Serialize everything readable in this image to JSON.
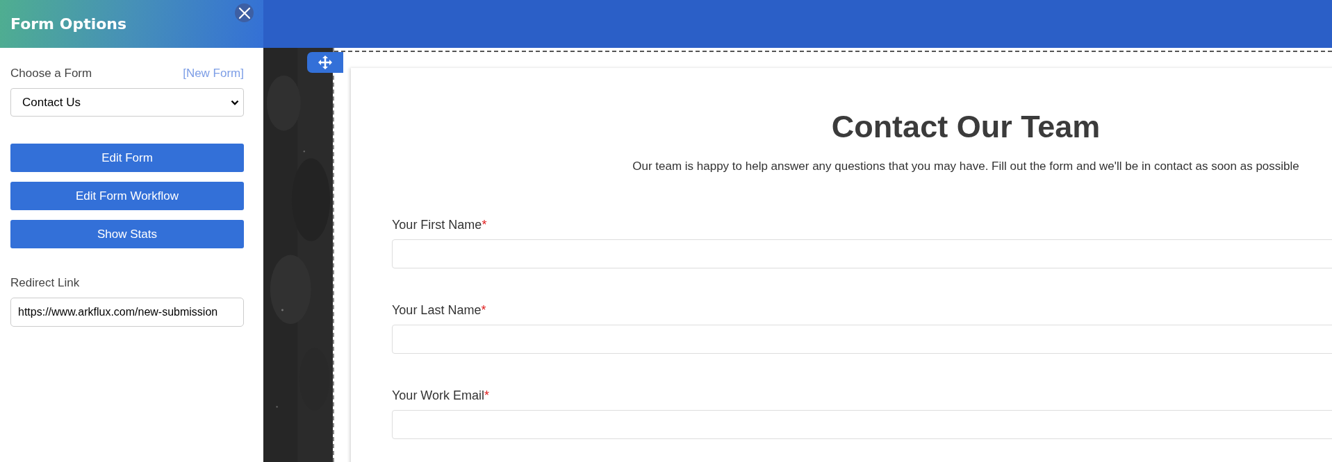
{
  "sidebar": {
    "title": "Form Options",
    "choose_label": "Choose a Form",
    "new_form_link": "[New Form]",
    "form_select": {
      "value": "Contact Us"
    },
    "buttons": [
      "Edit Form",
      "Edit Form Workflow",
      "Show Stats"
    ],
    "redirect_label": "Redirect Link",
    "redirect_field": {
      "value": "https://www.arkflux.com/new-submission"
    }
  },
  "form": {
    "title": "Contact Our Team",
    "subtitle": "Our team is happy to help answer any questions that you may have. Fill out the form and we'll be in contact as soon as possible",
    "fields": [
      {
        "label": "Your First Name",
        "required_mark": "*"
      },
      {
        "label": "Your Last Name",
        "required_mark": "*"
      },
      {
        "label": "Your Work Email",
        "required_mark": "*"
      }
    ]
  }
}
